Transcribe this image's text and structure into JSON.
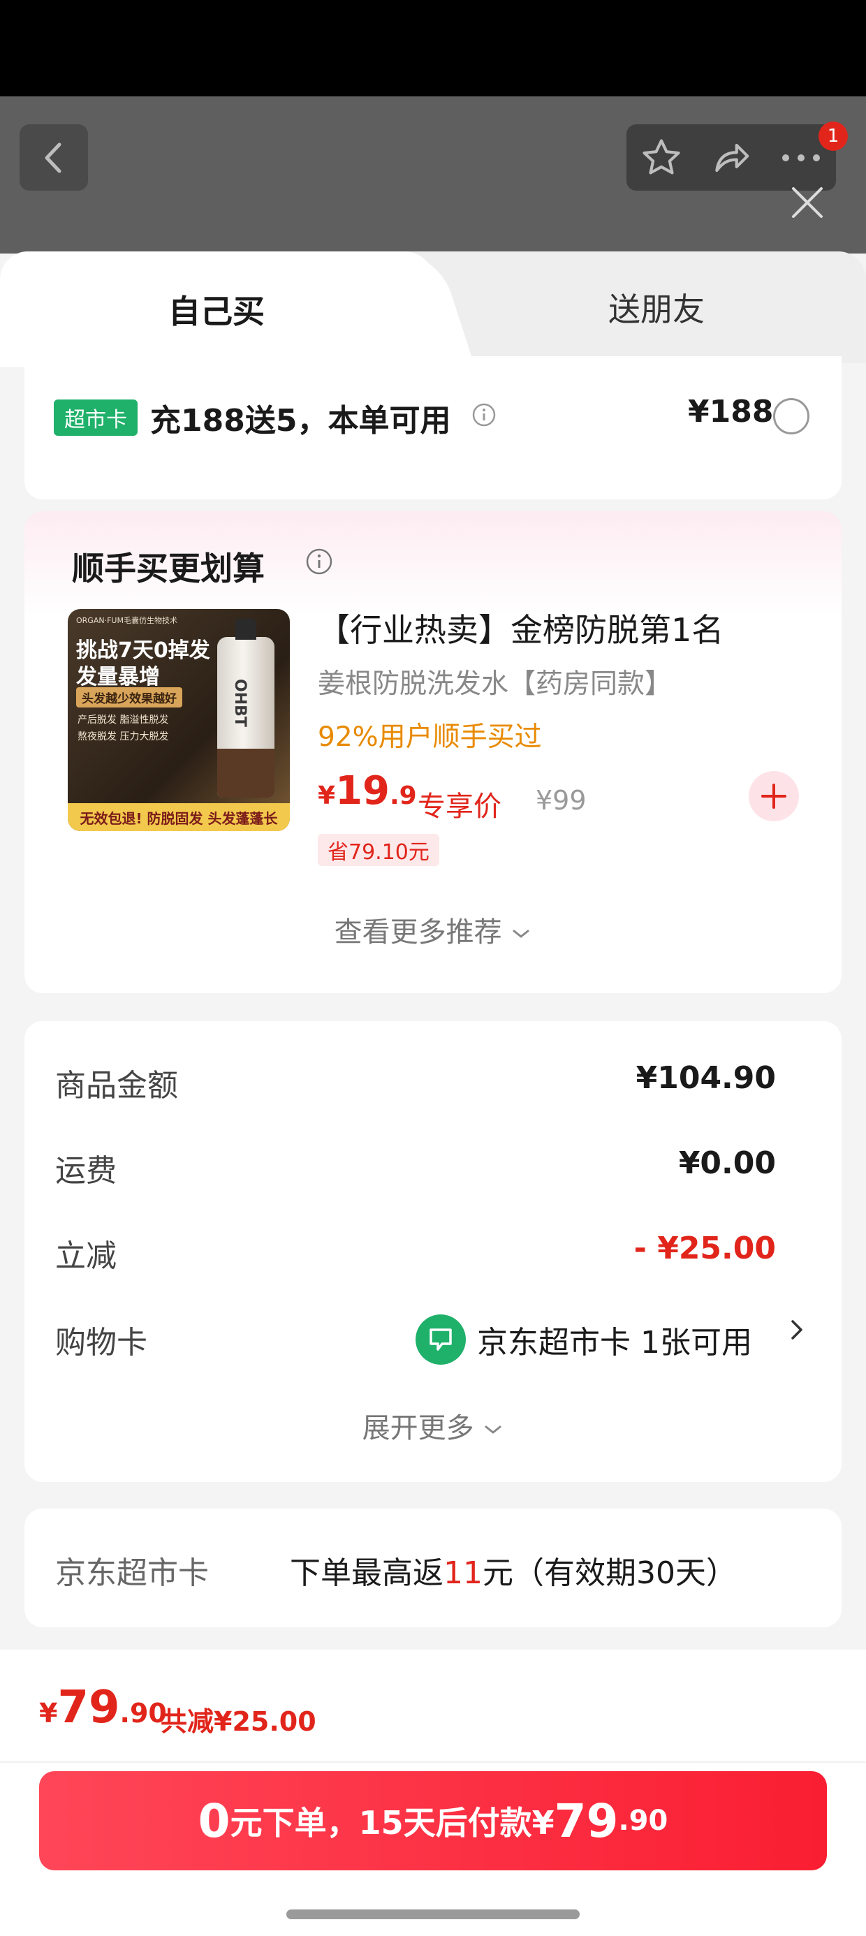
{
  "header": {
    "notification_count": "1"
  },
  "tabs": {
    "self_buy": "自己买",
    "gift_friend": "送朋友"
  },
  "topup": {
    "badge": "超市卡",
    "text": "充188送5，本单可用",
    "price": "¥188"
  },
  "recommend": {
    "title": "顺手买更划算",
    "product": {
      "image_lines": [
        "ORGAN·FUM毛囊仿生物技术",
        "挑战7天0掉发",
        "发量暴增",
        "头发越少效果越好",
        "产后脱发 脂溢性脱发",
        "熬夜脱发 压力大脱发",
        "无效包退! 防脱固发 头发蓬蓬长",
        "OHBT"
      ],
      "title": "【行业热卖】金榜防脱第1名",
      "subtitle": "姜根防脱洗发水【药房同款】",
      "bought": "92%用户顺手买过",
      "price_currency": "¥",
      "price_int": "19",
      "price_dec": ".9",
      "price_label": "专享价",
      "original_price": "¥99",
      "save_tag": "省79.10元"
    },
    "see_more": "查看更多推荐"
  },
  "summary": {
    "rows": [
      {
        "label": "商品金额",
        "value": "¥104.90"
      },
      {
        "label": "运费",
        "value": "¥0.00"
      },
      {
        "label": "立减",
        "value": "- ¥25.00"
      },
      {
        "label": "购物卡",
        "value": "京东超市卡 1张可用"
      }
    ],
    "expand_more": "展开更多"
  },
  "rebate": {
    "label": "京东超市卡",
    "text_pre": "下单最高返",
    "amount": "11",
    "text_post": "元（有效期30天）"
  },
  "bottom": {
    "total_currency": "¥",
    "total_int": "79",
    "total_dec": ".90",
    "total_saved": "共减¥25.00",
    "submit": {
      "part1": "0",
      "part2": "元下单，15天后付款¥",
      "part3": "79",
      "part4": ".90"
    }
  },
  "colors": {
    "accent_red": "#e1251b",
    "supermarket_green": "#1fb06a",
    "bought_orange": "#e88a00"
  }
}
